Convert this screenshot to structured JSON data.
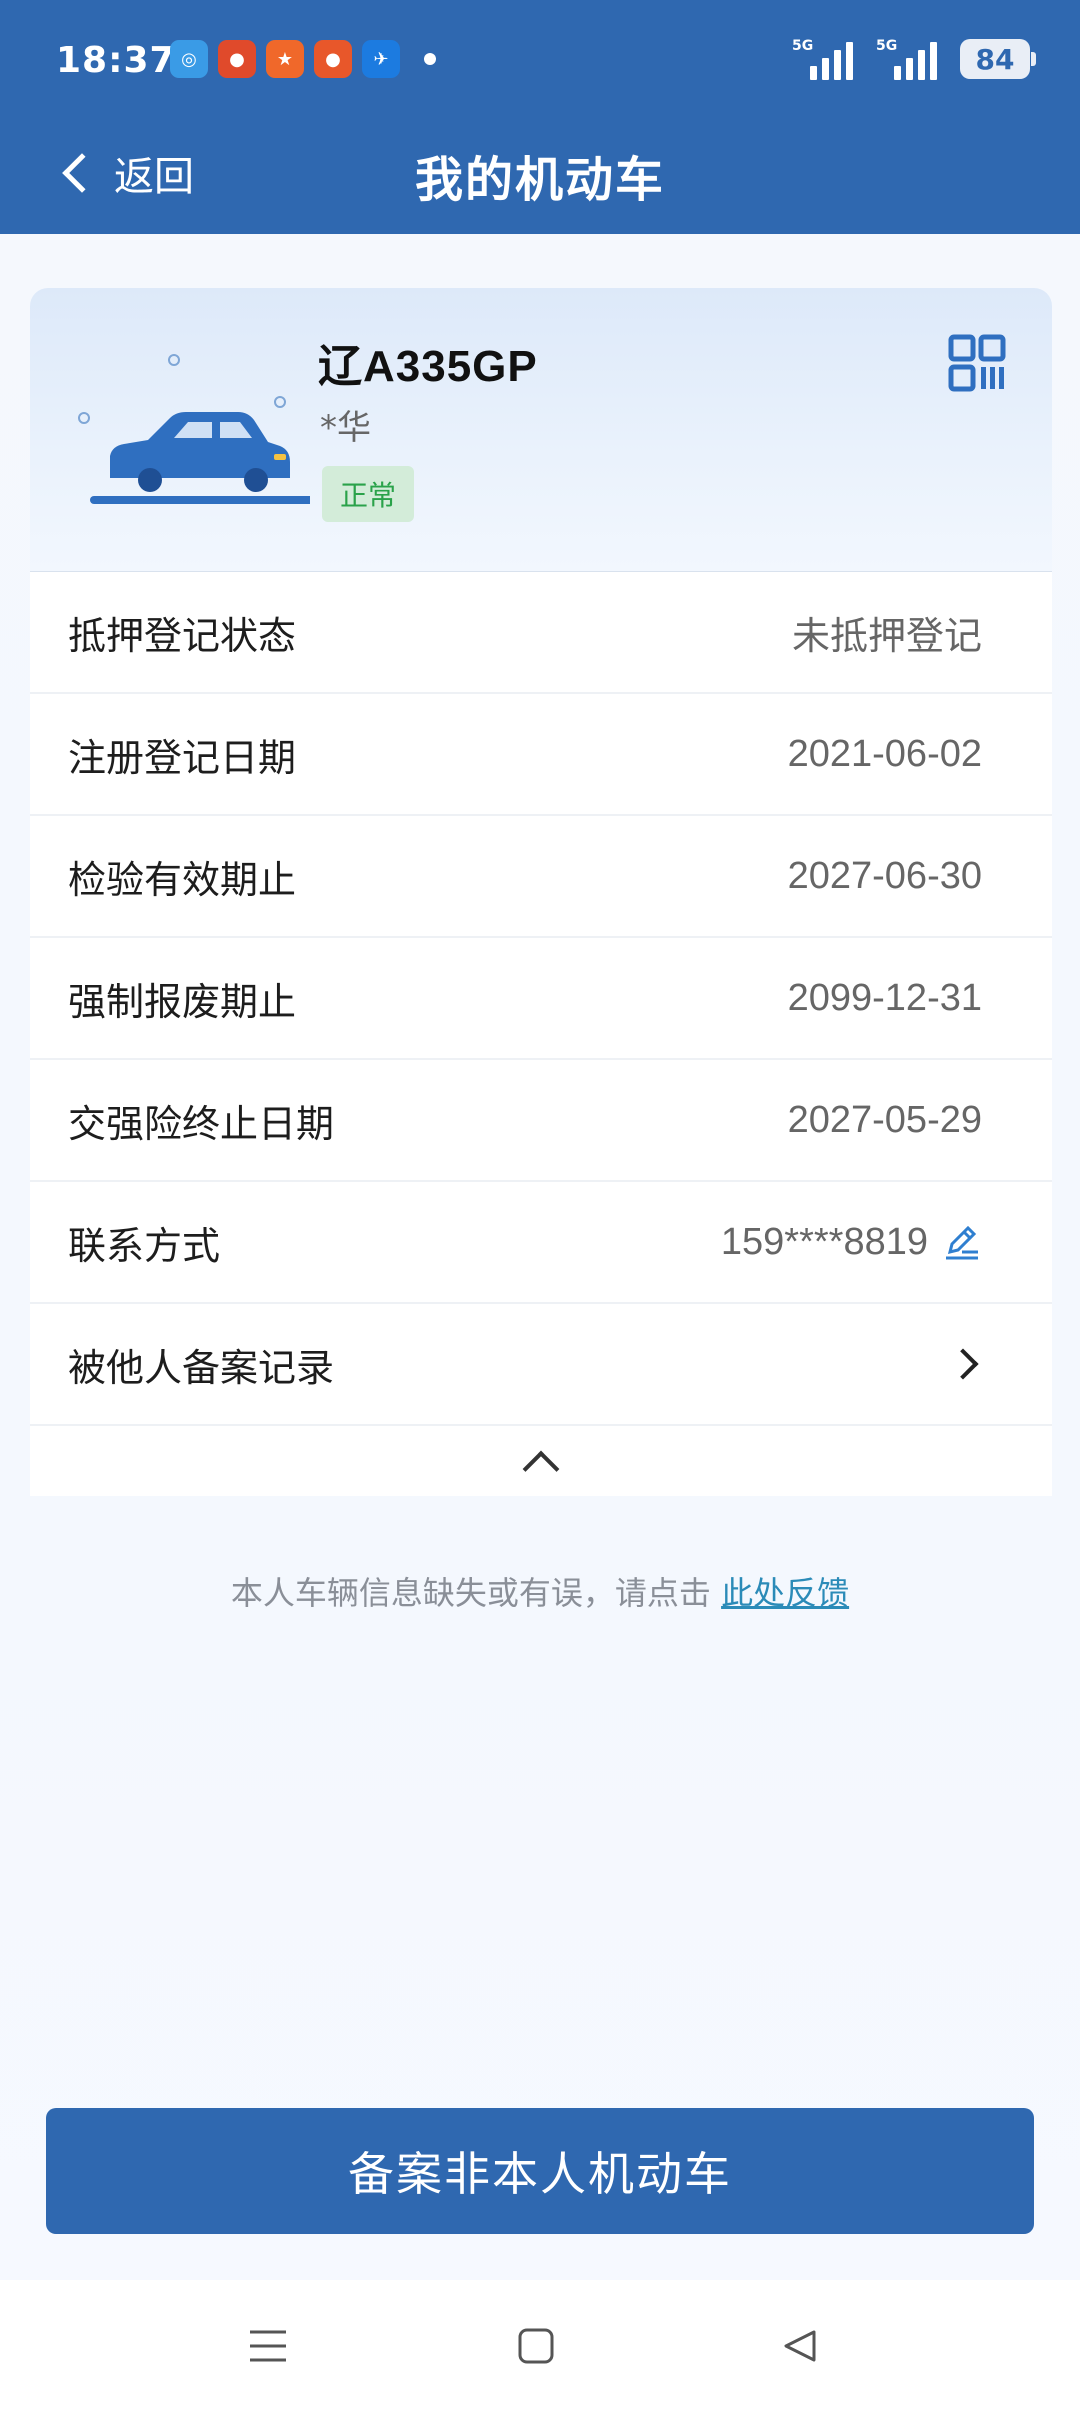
{
  "status_bar": {
    "time": "18:37",
    "network1": "5G",
    "network2": "5G",
    "battery": "84"
  },
  "header": {
    "back_label": "返回",
    "title": "我的机动车"
  },
  "vehicle": {
    "plate": "辽A335GP",
    "owner": "*华",
    "status": "正常"
  },
  "info_rows": [
    {
      "label": "抵押登记状态",
      "value": "未抵押登记"
    },
    {
      "label": "注册登记日期",
      "value": "2021-06-02"
    },
    {
      "label": "检验有效期止",
      "value": "2027-06-30"
    },
    {
      "label": "强制报废期止",
      "value": "2099-12-31"
    },
    {
      "label": "交强险终止日期",
      "value": "2027-05-29"
    },
    {
      "label": "联系方式",
      "value": "159****8819"
    },
    {
      "label": "被他人备案记录",
      "value": ""
    }
  ],
  "feedback": {
    "text": "本人车辆信息缺失或有误，请点击 ",
    "link": "此处反馈"
  },
  "register_button": "备案非本人机动车",
  "colors": {
    "primary": "#2f68b0",
    "badge_bg": "#d3ecd9",
    "badge_text": "#2aa24a",
    "link": "#2b8bb8"
  }
}
